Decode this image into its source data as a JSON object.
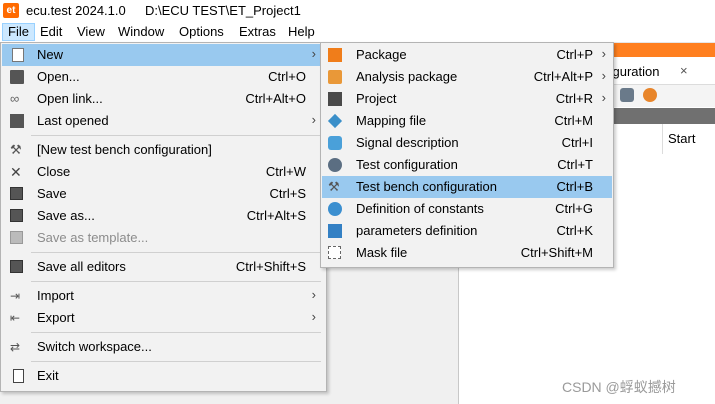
{
  "window": {
    "app_icon_text": "et",
    "title": "ecu.test 2024.1.0",
    "path": "D:\\ECU TEST\\ET_Project1"
  },
  "menubar": [
    "File",
    "Edit",
    "View",
    "Window",
    "Options",
    "Extras",
    "Help"
  ],
  "background": {
    "tab_label": "figuration",
    "tab_close": "×",
    "column_header": "Start"
  },
  "file_menu": {
    "items": [
      {
        "label": "New",
        "shortcut": "",
        "arrow": "›"
      },
      {
        "label": "Open...",
        "shortcut": "Ctrl+O"
      },
      {
        "label": "Open link...",
        "shortcut": "Ctrl+Alt+O"
      },
      {
        "label": "Last opened",
        "shortcut": "",
        "arrow": "›"
      },
      {
        "label": "[New test bench configuration]",
        "shortcut": ""
      },
      {
        "label": "Close",
        "shortcut": "Ctrl+W"
      },
      {
        "label": "Save",
        "shortcut": "Ctrl+S"
      },
      {
        "label": "Save as...",
        "shortcut": "Ctrl+Alt+S"
      },
      {
        "label": "Save as template...",
        "shortcut": ""
      },
      {
        "label": "Save all editors",
        "shortcut": "Ctrl+Shift+S"
      },
      {
        "label": "Import",
        "shortcut": "",
        "arrow": "›"
      },
      {
        "label": "Export",
        "shortcut": "",
        "arrow": "›"
      },
      {
        "label": "Switch workspace...",
        "shortcut": ""
      },
      {
        "label": "Exit",
        "shortcut": ""
      }
    ]
  },
  "new_submenu": {
    "items": [
      {
        "label": "Package",
        "shortcut": "Ctrl+P",
        "arrow": "›"
      },
      {
        "label": "Analysis package",
        "shortcut": "Ctrl+Alt+P",
        "arrow": "›"
      },
      {
        "label": "Project",
        "shortcut": "Ctrl+R",
        "arrow": "›"
      },
      {
        "label": "Mapping file",
        "shortcut": "Ctrl+M"
      },
      {
        "label": "Signal description",
        "shortcut": "Ctrl+I"
      },
      {
        "label": "Test configuration",
        "shortcut": "Ctrl+T"
      },
      {
        "label": "Test bench configuration",
        "shortcut": "Ctrl+B"
      },
      {
        "label": "Definition of constants",
        "shortcut": "Ctrl+G"
      },
      {
        "label": "parameters definition",
        "shortcut": "Ctrl+K"
      },
      {
        "label": "Mask file",
        "shortcut": "Ctrl+Shift+M"
      }
    ]
  },
  "icons": {
    "close": "✕",
    "tools": "⚒",
    "link": "∞",
    "arrow_import": "⇥",
    "arrow_export": "⇤",
    "switch": "⇄"
  },
  "watermark": "CSDN @蜉蚁撼树"
}
